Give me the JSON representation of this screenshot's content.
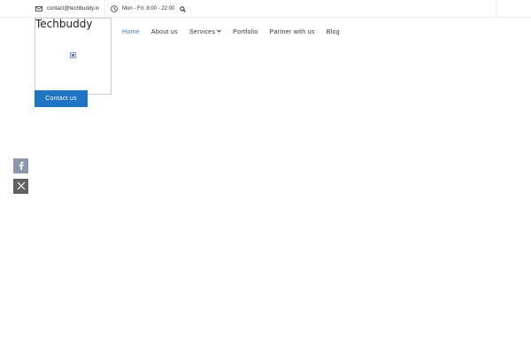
{
  "topbar": {
    "email": "contact@techbuddy.in",
    "hours": "Mon - Fri: 8:00 - 22:00",
    "icons": [
      "mail-icon",
      "clock-icon",
      "search-icon"
    ]
  },
  "logo": {
    "text": "Techbuddy"
  },
  "contact_button": {
    "label": "Contact us",
    "color": "#1f74c4"
  },
  "nav": {
    "items": [
      {
        "label": "Home",
        "active": true
      },
      {
        "label": "About us"
      },
      {
        "label": "Services",
        "dropdown": true
      },
      {
        "label": "Portfolio"
      },
      {
        "label": "Partner with us"
      },
      {
        "label": "Blog"
      }
    ],
    "active_color": "#3d7ec6"
  },
  "social": {
    "icons": [
      "facebook-icon",
      "x-twitter-icon"
    ]
  }
}
